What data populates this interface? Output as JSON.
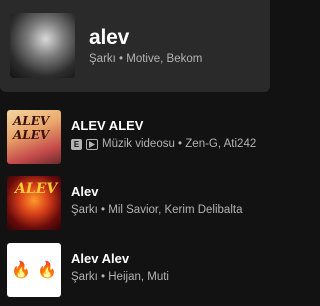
{
  "top_result": {
    "title": "alev",
    "subtitle": "Şarkı • Motive, Bekom"
  },
  "songs": [
    {
      "title": "ALEV ALEV",
      "explicit_badge": "E",
      "subtitle": "Müzik videosu • Zen-G, Ati242",
      "art_text": "ALEV ALEV"
    },
    {
      "title": "Alev",
      "subtitle": "Şarkı • Mil Savior, Kerim Delibalta",
      "art_text": "ALEV"
    },
    {
      "title": "Alev Alev",
      "subtitle": "Şarkı • Heijan, Muti",
      "art_emoji": "🔥"
    }
  ]
}
